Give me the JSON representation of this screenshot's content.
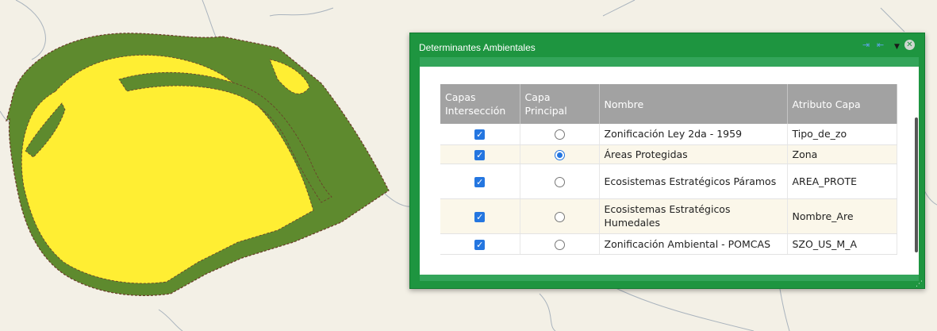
{
  "map": {
    "colors": {
      "background": "#f3f0e6",
      "polygon_outer": "#5e8a2e",
      "polygon_inner": "#ffee33",
      "roads": "#9aa7b5"
    }
  },
  "panel": {
    "title": "Determinantes Ambientales",
    "header_icons": [
      "pin-left-icon",
      "pin-right-icon",
      "collapse-icon",
      "close-icon"
    ],
    "colors": {
      "frame": "#1e9540",
      "strip": "#33a55a",
      "header_bg": "#a2a2a2",
      "check": "#2476e0"
    }
  },
  "table": {
    "headers": {
      "intersect_line1": "Capas",
      "intersect_line2": "Intersección",
      "principal_line1": "Capa",
      "principal_line2": "Principal",
      "name": "Nombre",
      "attribute": "Atributo Capa"
    },
    "rows": [
      {
        "intersect_checked": true,
        "principal_selected": false,
        "name": "Zonificación Ley 2da - 1959",
        "attribute": "Tipo_de_zo"
      },
      {
        "intersect_checked": true,
        "principal_selected": true,
        "name": "Áreas Protegidas",
        "attribute": "Zona"
      },
      {
        "intersect_checked": true,
        "principal_selected": false,
        "name": "Ecosistemas Estratégicos Páramos",
        "attribute": "AREA_PROTE"
      },
      {
        "intersect_checked": true,
        "principal_selected": false,
        "name": "Ecosistemas Estratégicos Humedales",
        "attribute": "Nombre_Are"
      },
      {
        "intersect_checked": true,
        "principal_selected": false,
        "name": "Zonificación Ambiental - POMCAS",
        "attribute": "SZO_US_M_A"
      }
    ]
  }
}
